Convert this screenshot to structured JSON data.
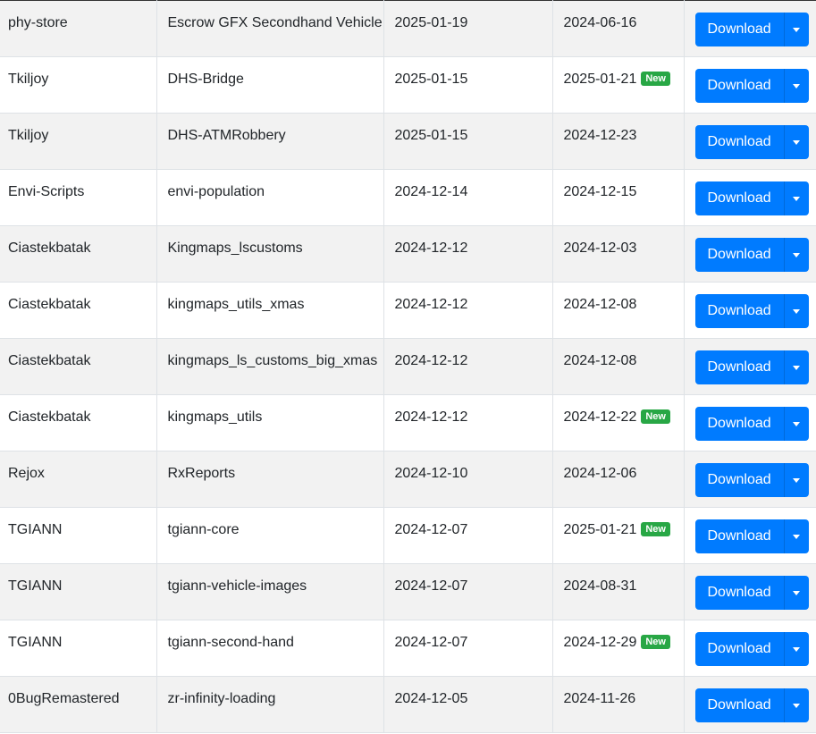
{
  "table": {
    "download_label": "Download",
    "new_badge": "New",
    "rows": [
      {
        "author": "phy-store",
        "name": "Escrow GFX Secondhand Vehicle",
        "released": "2025-01-19",
        "updated": "2024-06-16",
        "is_new": false
      },
      {
        "author": "Tkiljoy",
        "name": "DHS-Bridge",
        "released": "2025-01-15",
        "updated": "2025-01-21",
        "is_new": true
      },
      {
        "author": "Tkiljoy",
        "name": "DHS-ATMRobbery",
        "released": "2025-01-15",
        "updated": "2024-12-23",
        "is_new": false
      },
      {
        "author": "Envi-Scripts",
        "name": "envi-population",
        "released": "2024-12-14",
        "updated": "2024-12-15",
        "is_new": false
      },
      {
        "author": "Ciastekbatak",
        "name": "Kingmaps_lscustoms",
        "released": "2024-12-12",
        "updated": "2024-12-03",
        "is_new": false
      },
      {
        "author": "Ciastekbatak",
        "name": "kingmaps_utils_xmas",
        "released": "2024-12-12",
        "updated": "2024-12-08",
        "is_new": false
      },
      {
        "author": "Ciastekbatak",
        "name": "kingmaps_ls_customs_big_xmas",
        "released": "2024-12-12",
        "updated": "2024-12-08",
        "is_new": false
      },
      {
        "author": "Ciastekbatak",
        "name": "kingmaps_utils",
        "released": "2024-12-12",
        "updated": "2024-12-22",
        "is_new": true
      },
      {
        "author": "Rejox",
        "name": "RxReports",
        "released": "2024-12-10",
        "updated": "2024-12-06",
        "is_new": false
      },
      {
        "author": "TGIANN",
        "name": "tgiann-core",
        "released": "2024-12-07",
        "updated": "2025-01-21",
        "is_new": true
      },
      {
        "author": "TGIANN",
        "name": "tgiann-vehicle-images",
        "released": "2024-12-07",
        "updated": "2024-08-31",
        "is_new": false
      },
      {
        "author": "TGIANN",
        "name": "tgiann-second-hand",
        "released": "2024-12-07",
        "updated": "2024-12-29",
        "is_new": true
      },
      {
        "author": "0BugRemastered",
        "name": "zr-infinity-loading",
        "released": "2024-12-05",
        "updated": "2024-11-26",
        "is_new": false
      }
    ]
  },
  "colors": {
    "primary": "#007bff",
    "badge_new": "#28a745",
    "row_stripe": "#f2f2f2"
  },
  "icons": {
    "dropdown_toggle": "caret-down-icon"
  }
}
